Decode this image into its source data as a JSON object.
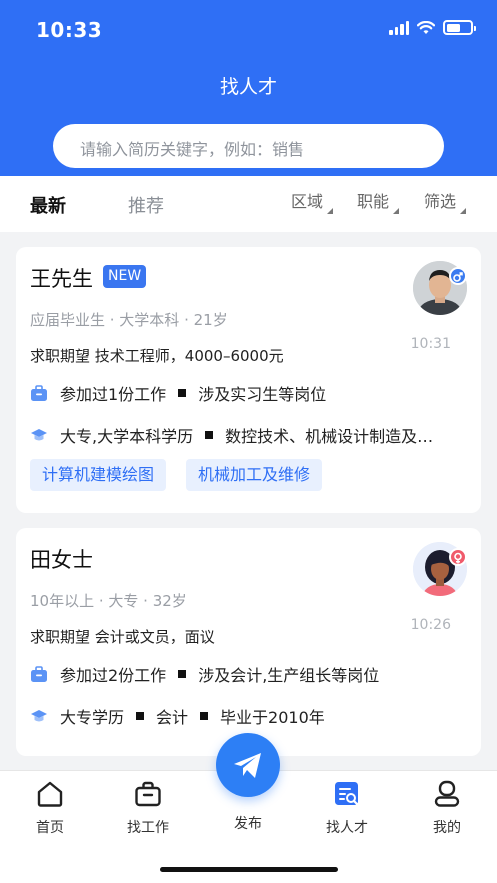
{
  "status_bar": {
    "time": "10:33"
  },
  "header": {
    "title": "找人才"
  },
  "search": {
    "placeholder": "请输入简历关键字，例如：销售"
  },
  "tabs": {
    "latest": "最新",
    "recommend": "推荐"
  },
  "filters": [
    "区域",
    "职能",
    "筛选"
  ],
  "candidates": [
    {
      "name": "王先生",
      "badge": "NEW",
      "meta": "应届毕业生 · 大学本科 · 21岁",
      "expectation": "求职期望 技术工程师，4000–6000元",
      "time": "10:31",
      "work": {
        "count_text": "参加过1份工作",
        "scope": "涉及实习生等岗位"
      },
      "education": {
        "degree": "大专,大学本科学历",
        "major": "数控技术、机械设计制造及…"
      },
      "tags": [
        "计算机建模绘图",
        "机械加工及维修"
      ],
      "gender": "male"
    },
    {
      "name": "田女士",
      "meta": "10年以上 · 大专 · 32岁",
      "expectation": "求职期望 会计或文员，面议",
      "time": "10:26",
      "work": {
        "count_text": "参加过2份工作",
        "scope": "涉及会计,生产组长等岗位"
      },
      "education": {
        "degree": "大专学历",
        "major": "会计",
        "graduation": "毕业于2010年"
      },
      "gender": "female"
    }
  ],
  "tabbar": {
    "home": "首页",
    "find_job": "找工作",
    "publish": "发布",
    "find_talent": "找人才",
    "mine": "我的"
  },
  "colors": {
    "brand_blue": "#2f6ff5",
    "tag_bg": "#e8f0fe",
    "male_badge": "#3a7bf0",
    "female_badge": "#f05a6b"
  },
  "icons": [
    "signal-icon",
    "wifi-icon",
    "battery-icon",
    "briefcase-icon",
    "graduation-cap-icon",
    "male-icon",
    "female-icon",
    "home-icon",
    "find-job-icon",
    "send-icon",
    "find-talent-icon",
    "profile-icon"
  ]
}
